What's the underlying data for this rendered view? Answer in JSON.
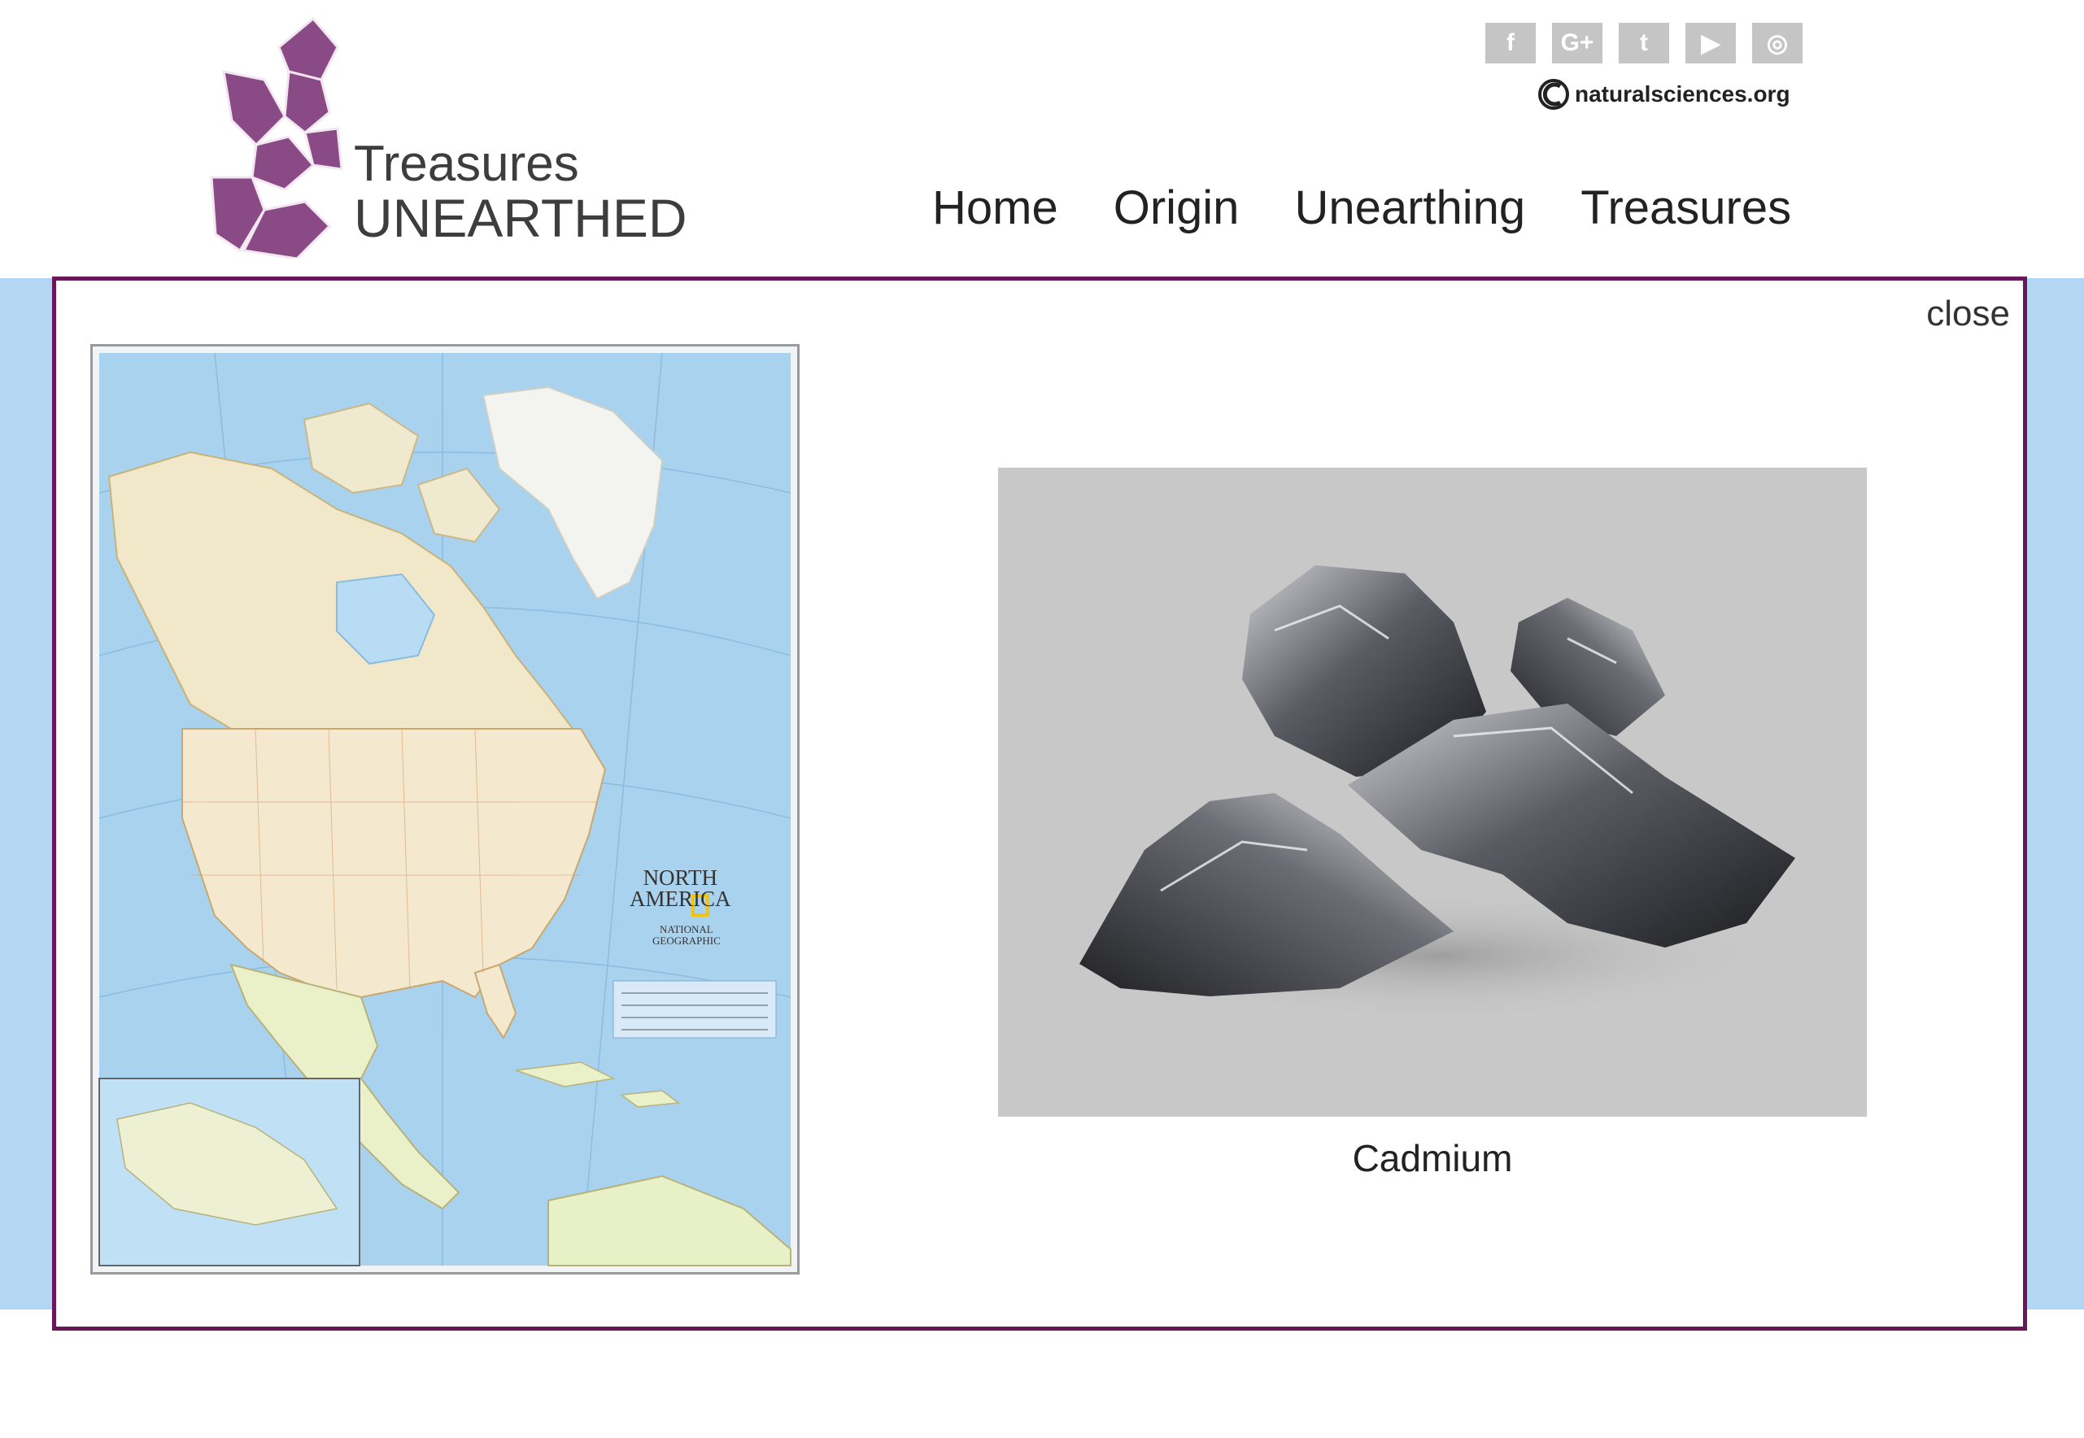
{
  "logo": {
    "line1": "Treasures",
    "line2": "UNEARTHED"
  },
  "social": [
    {
      "name": "facebook",
      "glyph": "f"
    },
    {
      "name": "google-plus",
      "glyph": "G+"
    },
    {
      "name": "twitter",
      "glyph": "t"
    },
    {
      "name": "youtube",
      "glyph": "▶"
    },
    {
      "name": "instagram",
      "glyph": "◎"
    }
  ],
  "site_link": "naturalsciences.org",
  "nav": {
    "home": "Home",
    "origin": "Origin",
    "unearthing": "Unearthing",
    "treasures": "Treasures"
  },
  "modal": {
    "close_label": "close",
    "map_title_line1": "NORTH",
    "map_title_line2": "AMERICA",
    "map_brand_line1": "NATIONAL",
    "map_brand_line2": "GEOGRAPHIC",
    "specimen_caption": "Cadmium"
  },
  "colors": {
    "accent": "#6a1759",
    "logo_purple": "#8a4a86",
    "background_band": "#b3d7f2"
  }
}
